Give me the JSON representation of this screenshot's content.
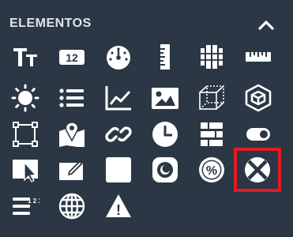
{
  "panel": {
    "title": "ELEMENTOS",
    "collapse_icon": "chevron-up-icon"
  },
  "elements": [
    {
      "icon": "text-icon"
    },
    {
      "icon": "number-icon",
      "text": "12"
    },
    {
      "icon": "gauge-icon"
    },
    {
      "icon": "vertical-ruler-icon"
    },
    {
      "icon": "heatmap-icon"
    },
    {
      "icon": "horizontal-ruler-icon"
    },
    {
      "icon": "sun-icon"
    },
    {
      "icon": "list-icon"
    },
    {
      "icon": "line-chart-icon"
    },
    {
      "icon": "image-icon"
    },
    {
      "icon": "cube-outline-icon"
    },
    {
      "icon": "3d-box-icon"
    },
    {
      "icon": "select-area-icon"
    },
    {
      "icon": "map-pin-icon"
    },
    {
      "icon": "link-icon"
    },
    {
      "icon": "clock-icon"
    },
    {
      "icon": "table-stack-icon"
    },
    {
      "icon": "toggle-icon"
    },
    {
      "icon": "cursor-select-icon"
    },
    {
      "icon": "edit-icon"
    },
    {
      "icon": "square-icon"
    },
    {
      "icon": "ring-gauge-icon"
    },
    {
      "icon": "percent-icon",
      "text": "%"
    },
    {
      "icon": "cancel-circle-icon",
      "selected": true
    },
    {
      "icon": "numbered-list-icon",
      "text": "1 2 3"
    },
    {
      "icon": "globe-icon"
    },
    {
      "icon": "warning-icon",
      "text": "!"
    }
  ],
  "colors": {
    "background": "#2b3744",
    "icon": "#ffffff",
    "title": "#dfe5ea",
    "selected_outline": "#e21b22"
  }
}
